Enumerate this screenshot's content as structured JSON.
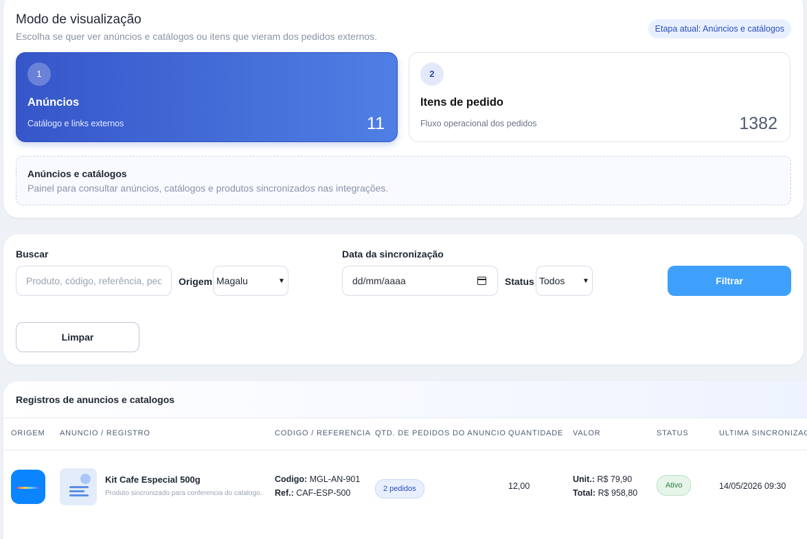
{
  "mode": {
    "title": "Modo de visualização",
    "subtitle": "Escolha se quer ver anúncios e catálogos ou itens que vieram dos pedidos externos.",
    "stage_badge": "Etapa atual: Anúncios e catálogos",
    "options": [
      {
        "number": "1",
        "label": "Anúncios",
        "description": "Catálogo e links externos",
        "count": "11",
        "selected": true
      },
      {
        "number": "2",
        "label": "Itens de pedido",
        "description": "Fluxo operacional dos pedidos",
        "count": "1382",
        "selected": false
      }
    ],
    "info": {
      "title": "Anúncios e catálogos",
      "description": "Painel para consultar anúncios, catálogos e produtos sincronizados nas integrações."
    }
  },
  "filters": {
    "search_label": "Buscar",
    "search_placeholder": "Produto, código, referência, pedido",
    "origin_label": "Origem",
    "origin_value": "Magalu",
    "date_label": "Data da sincronização",
    "date_placeholder": "dd/mm/aaaa",
    "status_label": "Status",
    "status_value": "Todos",
    "filter_button": "Filtrar",
    "clear_button": "Limpar"
  },
  "table": {
    "title": "Registros de anuncios e catalogos",
    "columns": [
      "ORIGEM",
      "ANUNCIO / REGISTRO",
      "CODIGO / REFERENCIA",
      "QTD. DE PEDIDOS DO ANUNCIO",
      "QUANTIDADE",
      "VALOR",
      "STATUS",
      "ULTIMA SINCRONIZACAO"
    ],
    "rows": [
      {
        "name": "Kit Cafe Especial 500g",
        "description": "Produto sincronizado para conferencia do catalogo.",
        "code_label": "Codigo:",
        "code": "MGL-AN-901",
        "ref_label": "Ref.:",
        "ref": "CAF-ESP-500",
        "orders": "2 pedidos",
        "quantity": "12,00",
        "unit_label": "Unit.:",
        "unit_value": "R$ 79,90",
        "total_label": "Total:",
        "total_value": "R$ 958,80",
        "status": "Ativo",
        "last_sync": "14/05/2026 09:30"
      }
    ]
  },
  "colors": {
    "primary_gradient_start": "#3656c9",
    "primary_gradient_end": "#4f7fe4",
    "filter_button": "#3ea0fb",
    "status_active": "#2c7a3f"
  }
}
